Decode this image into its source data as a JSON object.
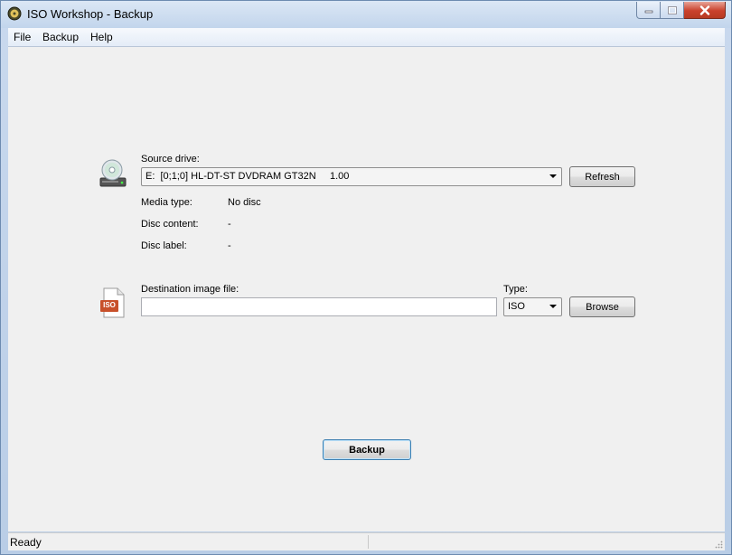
{
  "window": {
    "title": "ISO Workshop - Backup"
  },
  "menu": [
    {
      "label": "File"
    },
    {
      "label": "Backup"
    },
    {
      "label": "Help"
    }
  ],
  "source": {
    "label": "Source drive:",
    "selected": "E:  [0;1;0] HL-DT-ST DVDRAM GT32N     1.00",
    "refresh_label": "Refresh",
    "info": [
      {
        "key": "Media type:",
        "value": "No disc"
      },
      {
        "key": "Disc content:",
        "value": "-"
      },
      {
        "key": "Disc label:",
        "value": "-"
      }
    ]
  },
  "destination": {
    "label": "Destination image file:",
    "value": "",
    "type_label": "Type:",
    "type_value": "ISO",
    "browse_label": "Browse",
    "icon_text": "ISO"
  },
  "backup_label": "Backup",
  "status": {
    "text": "Ready"
  },
  "colors": {
    "accent": "#3c7fb1",
    "close": "#c9412c",
    "iso_badge": "#c8502a"
  }
}
